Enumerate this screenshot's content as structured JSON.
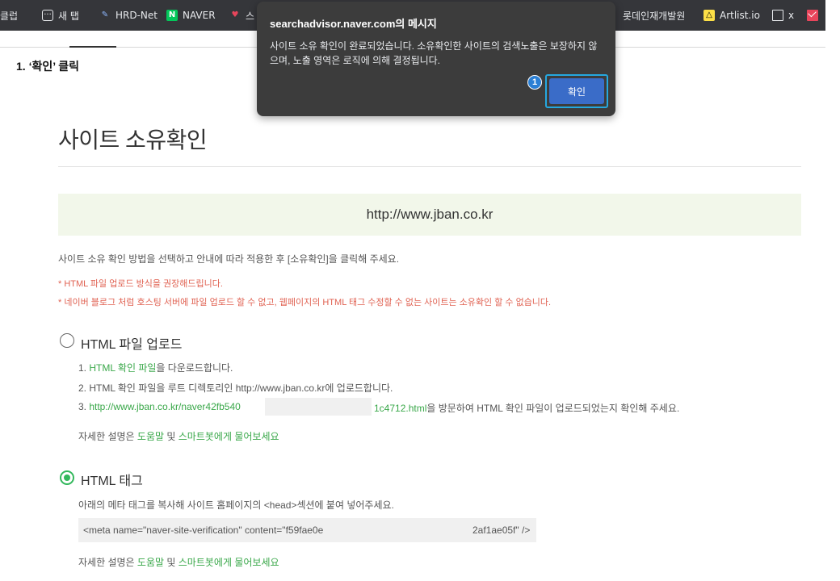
{
  "bookmarks": {
    "left": [
      {
        "label": "클럽",
        "icon": "none"
      },
      {
        "label": "새 탭",
        "icon": "new-tab-icon"
      },
      {
        "label": "HRD-Net",
        "icon": "hrd-net-icon"
      },
      {
        "label": "NAVER",
        "icon": "naver-icon"
      },
      {
        "label": "스",
        "icon": "heart-icon"
      }
    ],
    "right": [
      {
        "label": "롯데인재개발원",
        "icon": "none"
      },
      {
        "label": "Artlist.io",
        "icon": "artlist-icon"
      },
      {
        "label": "x",
        "icon": "document-icon"
      },
      {
        "label": "",
        "icon": "mail-icon"
      }
    ]
  },
  "step": {
    "label": "1. ‘확인’ 클릭"
  },
  "dialog": {
    "title": "searchadvisor.naver.com의 메시지",
    "message": "사이트 소유 확인이 완료되었습니다. 소유확인한 사이트의 검색노출은 보장하지 않으며, 노출 영역은 로직에 의해 결정됩니다.",
    "ok_label": "확인",
    "badge": "1",
    "highlight_color": "#25a8e0"
  },
  "page": {
    "title": "사이트 소유확인",
    "site_url": "http://www.jban.co.kr",
    "guide": "사이트 소유 확인 방법을 선택하고 안내에 따라 적용한 후 [소유확인]을 클릭해 주세요.",
    "notes": [
      "* HTML 파일 업로드 방식을 권장해드립니다.",
      "* 네이버 블로그 처럼 호스팅 서버에 파일 업로드 할 수 없고, 웹페이지의 HTML 태그 수정할 수 없는 사이트는 소유확인 할 수 없습니다."
    ],
    "accent_color": "#33b85c"
  },
  "options": {
    "file_upload": {
      "label": "HTML 파일 업로드",
      "selected": false,
      "step1_prefix": "1. ",
      "step1_link": "HTML 확인 파일",
      "step1_suffix": "을 다운로드합니다.",
      "step2": "2. HTML 확인 파일을 루트 디렉토리인 http://www.jban.co.kr에 업로드합니다.",
      "step3_prefix": "3. ",
      "step3_link_start": "http://www.jban.co.kr/naver42fb540",
      "step3_link_end": "1c4712.html",
      "step3_suffix": "을 방문하여 HTML 확인 파일이 업로드되었는지 확인해 주세요."
    },
    "html_tag": {
      "label": "HTML 태그",
      "selected": true,
      "desc": "아래의 메타 태그를 복사해 사이트 홈페이지의 <head>섹션에 붙여 넣어주세요.",
      "meta_start": "<meta name=\"naver-site-verification\" content=\"f59fae0e",
      "meta_end": "2af1ae05f\" />"
    }
  },
  "help": {
    "prefix": "자세한 설명은 ",
    "link1": "도움말",
    "middle": " 및 ",
    "link2": "스마트봇에게 물어보세요"
  }
}
